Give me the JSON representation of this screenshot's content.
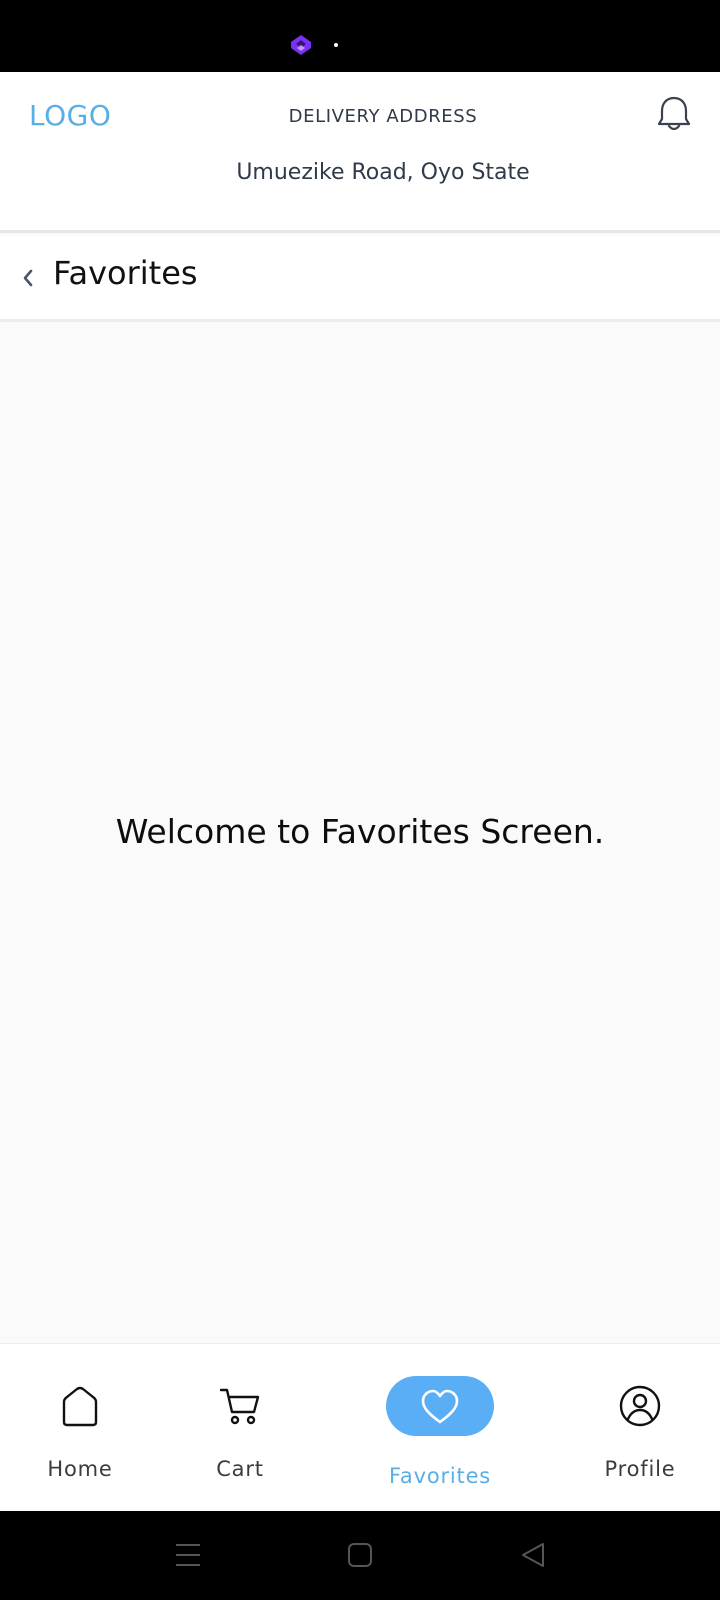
{
  "status_bar": {
    "icons": [
      "app-notification-icon",
      "dot-indicator"
    ],
    "icon_color": "#8a2be2"
  },
  "header": {
    "logo": "LOGO",
    "delivery_label": "DELIVERY ADDRESS",
    "delivery_address": "Umuezike Road, Oyo State",
    "accent_color": "#5aaee6",
    "notification_icon": "bell-icon"
  },
  "title_bar": {
    "back_icon": "chevron-left-icon",
    "title": "Favorites"
  },
  "content": {
    "message": "Welcome to Favorites Screen."
  },
  "bottom_nav": {
    "items": [
      {
        "label": "Home",
        "icon": "home-icon",
        "active": false
      },
      {
        "label": "Cart",
        "icon": "cart-icon",
        "active": false
      },
      {
        "label": "Favorites",
        "icon": "heart-icon",
        "active": true
      },
      {
        "label": "Profile",
        "icon": "profile-icon",
        "active": false
      }
    ],
    "active_color": "#5aaef5"
  },
  "system_nav": {
    "buttons": [
      "menu-icon",
      "home-square-icon",
      "back-triangle-icon"
    ]
  }
}
